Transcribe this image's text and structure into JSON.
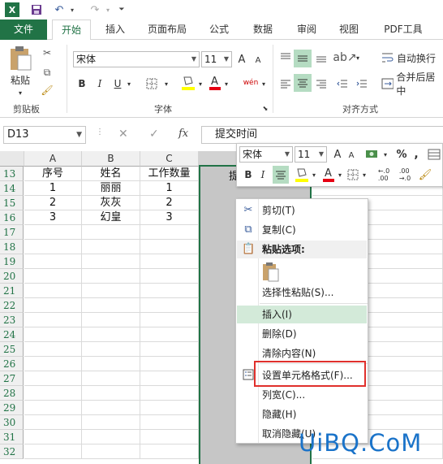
{
  "quick_access": {
    "undo": "↶",
    "redo": "↷"
  },
  "tabs": [
    "文件",
    "开始",
    "插入",
    "页面布局",
    "公式",
    "数据",
    "审阅",
    "视图",
    "PDF工具"
  ],
  "ribbon": {
    "clipboard": {
      "paste": "粘贴",
      "label": "剪贴板"
    },
    "font": {
      "name": "宋体",
      "size": "11",
      "grow": "A",
      "shrink": "A",
      "bold": "B",
      "italic": "I",
      "underline": "U",
      "wen": "wén",
      "label": "字体"
    },
    "align": {
      "wrap": "自动换行",
      "merge": "合并后居中",
      "label": "对齐方式"
    }
  },
  "formula_bar": {
    "name_box": "D13",
    "fx": "fx",
    "value": "提交时间"
  },
  "columns": [
    "A",
    "B",
    "C"
  ],
  "rows": [
    {
      "num": "13",
      "a": "序号",
      "b": "姓名",
      "c": "工作数量",
      "d": "提"
    },
    {
      "num": "14",
      "a": "1",
      "b": "丽丽",
      "c": "1",
      "d": ""
    },
    {
      "num": "15",
      "a": "2",
      "b": "灰灰",
      "c": "2",
      "d": ""
    },
    {
      "num": "16",
      "a": "3",
      "b": "幻皇",
      "c": "3",
      "d": ""
    },
    {
      "num": "17"
    },
    {
      "num": "18"
    },
    {
      "num": "19"
    },
    {
      "num": "20"
    },
    {
      "num": "21"
    },
    {
      "num": "22"
    },
    {
      "num": "23"
    },
    {
      "num": "24"
    },
    {
      "num": "25"
    },
    {
      "num": "26"
    },
    {
      "num": "27"
    },
    {
      "num": "28"
    },
    {
      "num": "29"
    },
    {
      "num": "30"
    },
    {
      "num": "31"
    },
    {
      "num": "32"
    }
  ],
  "mini_toolbar": {
    "font": "宋体",
    "size": "11",
    "percent": "%",
    "comma": ","
  },
  "context_menu": {
    "cut": "剪切(T)",
    "copy": "复制(C)",
    "paste_options": "粘贴选项:",
    "paste_special": "选择性粘贴(S)...",
    "insert": "插入(I)",
    "delete": "删除(D)",
    "clear": "清除内容(N)",
    "format_cells": "设置单元格格式(F)...",
    "col_width": "列宽(C)...",
    "hide": "隐藏(H)",
    "unhide": "取消隐藏(U)"
  },
  "watermark": "UiBQ.CoM",
  "colors": {
    "brand_green": "#217346",
    "highlight": "#b5dcc2",
    "red_box": "#e0302c"
  }
}
